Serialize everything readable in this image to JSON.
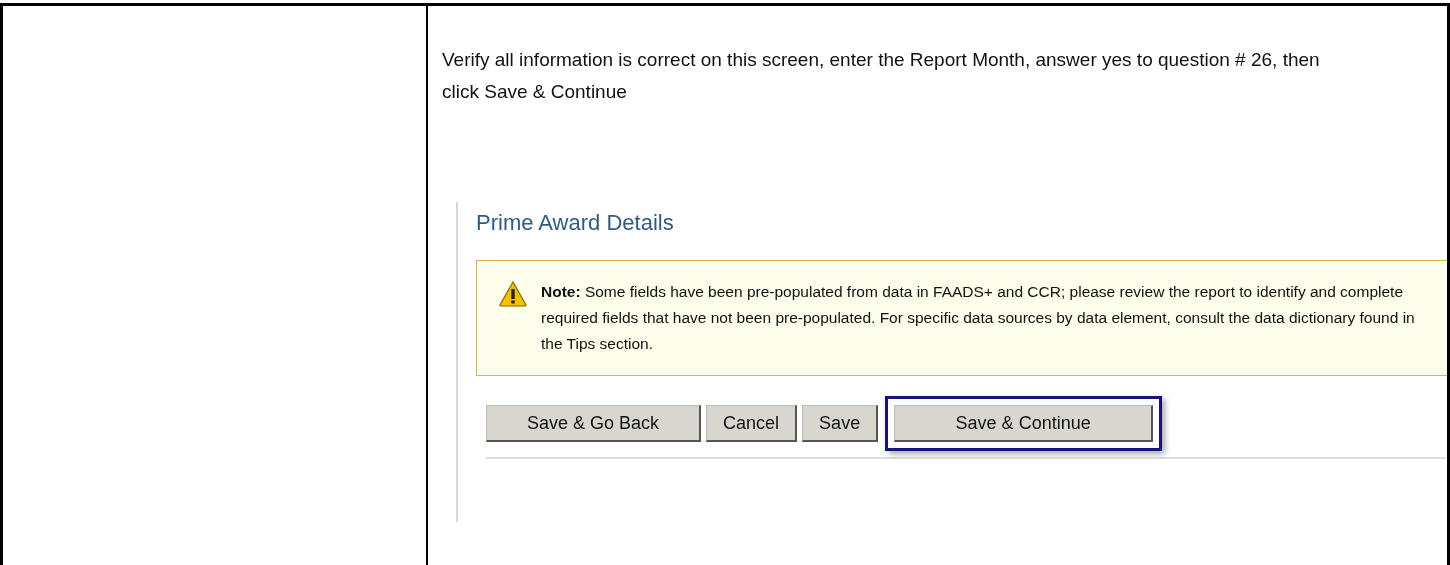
{
  "instruction": "Verify all information is correct on this screen,  enter the Report Month, answer yes to question # 26, then click Save & Continue",
  "screenshot": {
    "title": "Prime Award Details",
    "note": "**Note:** Some fields have been pre-populated from data in FAADS+ and CCR; please review the report to identify and complete required fields that have not been pre-populated. For specific data sources by data element, consult the data dictionary found in the Tips section.",
    "buttons": [
      {
        "label": "Save & Go Back",
        "highlighted": false
      },
      {
        "label": "Cancel",
        "highlighted": false
      },
      {
        "label": "Save",
        "highlighted": false
      },
      {
        "label": "Save & Continue",
        "highlighted": true
      }
    ]
  }
}
